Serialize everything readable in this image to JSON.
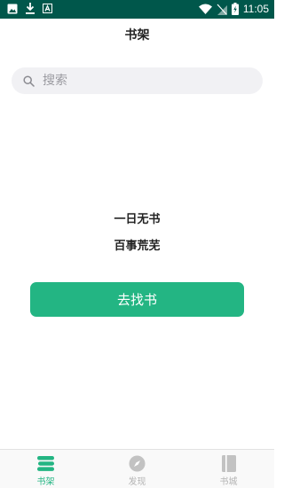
{
  "status_bar": {
    "time": "11:05",
    "left_icons": [
      "image-icon",
      "download-icon",
      "app-a-icon"
    ],
    "right_icons": [
      "wifi-icon",
      "no-sim-icon",
      "battery-charging-icon"
    ],
    "background": "#00574b"
  },
  "header": {
    "title": "书架"
  },
  "search": {
    "placeholder": "搜索",
    "value": "",
    "icon": "search-icon"
  },
  "empty_state": {
    "line1": "一日无书",
    "line2": "百事荒芜"
  },
  "find_button": {
    "label": "去找书",
    "color": "#23b583"
  },
  "tab_bar": {
    "active_color": "#23b583",
    "inactive_color": "#b4b4b4",
    "tabs": [
      {
        "label": "书架",
        "icon": "bookshelf-icon",
        "active": true
      },
      {
        "label": "发现",
        "icon": "compass-icon",
        "active": false
      },
      {
        "label": "书城",
        "icon": "book-icon",
        "active": false
      }
    ]
  }
}
